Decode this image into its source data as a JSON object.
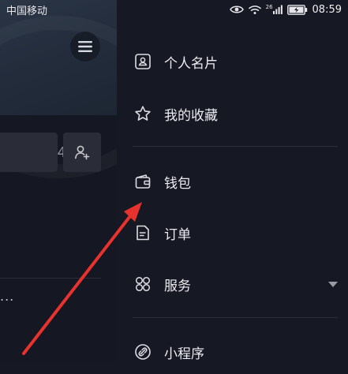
{
  "status_bar": {
    "carrier": "中国移动",
    "network_label": "26",
    "time": "08:59"
  },
  "background": {
    "button_fragment": "4",
    "dots": "..."
  },
  "drawer": {
    "items": [
      {
        "label": "个人名片",
        "icon": "id-card-icon"
      },
      {
        "label": "我的收藏",
        "icon": "star-icon"
      },
      {
        "label": "钱包",
        "icon": "wallet-icon"
      },
      {
        "label": "订单",
        "icon": "order-document-icon"
      },
      {
        "label": "服务",
        "icon": "services-grid-icon",
        "expandable": true
      },
      {
        "label": "小程序",
        "icon": "mini-program-link-icon"
      }
    ]
  },
  "colors": {
    "background": "#161823",
    "annotation_arrow": "#e8322e",
    "text": "#ececf0"
  }
}
